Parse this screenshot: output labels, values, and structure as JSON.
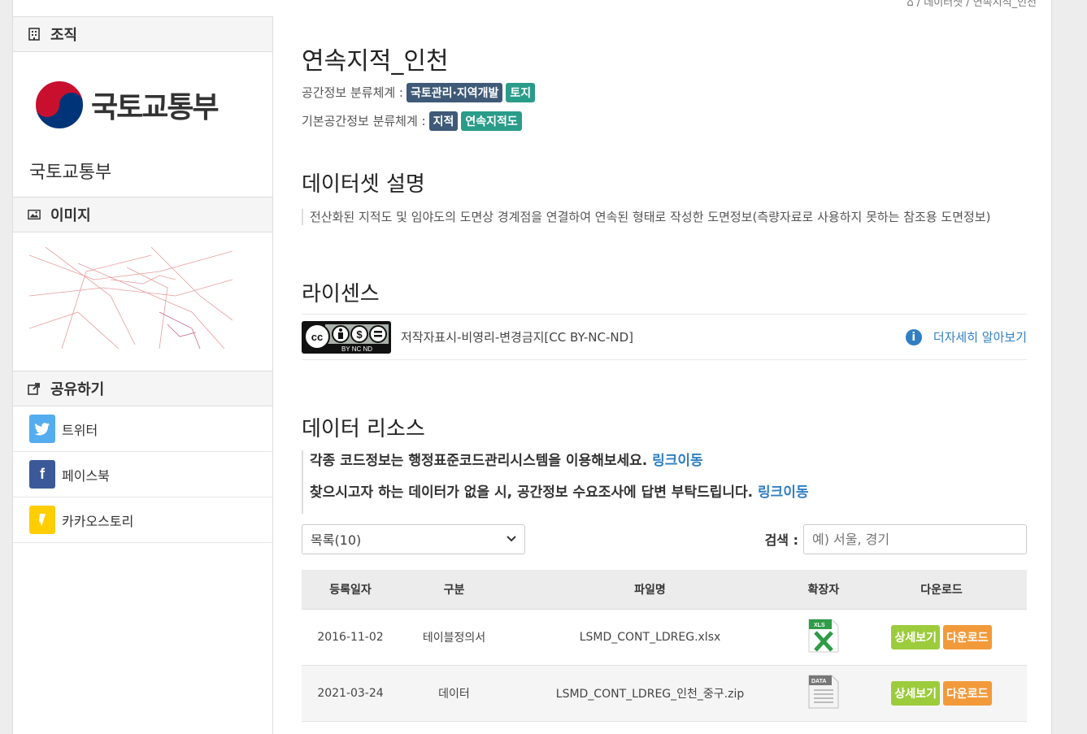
{
  "breadcrumb": {
    "text": "⌂ / 데이터셋 / 연속지적_인천"
  },
  "sidebar": {
    "org_header": "조직",
    "org_logo_text": "국토교통부",
    "org_name": "국토교통부",
    "image_header": "이미지",
    "share_header": "공유하기",
    "share_items": [
      {
        "label": "트위터",
        "icon": "twitter-icon",
        "color": "#55acee"
      },
      {
        "label": "페이스북",
        "icon": "facebook-icon",
        "color": "#3b5998"
      },
      {
        "label": "카카오스토리",
        "icon": "kakaostory-icon",
        "color": "#ffcd00"
      }
    ]
  },
  "dataset": {
    "title": "연속지적_인천",
    "spatial_label": "공간정보 분류체계 :",
    "spatial_tags": [
      "국토관리·지역개발",
      "토지"
    ],
    "base_label": "기본공간정보 분류체계 :",
    "base_tags": [
      "지적",
      "연속지적도"
    ]
  },
  "description": {
    "heading": "데이터셋 설명",
    "text": "전산화된 지적도 및 임야도의 도면상 경계점을 연결하여 연속된 형태로 작성한 도면정보(측량자료로 사용하지 못하는 참조용 도면정보)"
  },
  "license": {
    "heading": "라이센스",
    "badge": "cc BY NC ND",
    "text": "저작자표시-비영리-변경금지[CC BY-NC-ND]",
    "more_label": "더자세히 알아보기"
  },
  "resources": {
    "heading": "데이터 리소스",
    "notice1": "각종 코드정보는 행정표준코드관리시스템을 이용해보세요.",
    "notice2": "찾으시고자 하는 데이터가 없을 시, 공간정보 수요조사에 답변 부탁드립니다.",
    "link_label": "링크이동",
    "select_value": "목록(10)",
    "search_label": "검색 :",
    "search_placeholder": "예) 서울, 경기",
    "columns": [
      "등록일자",
      "구분",
      "파일명",
      "확장자",
      "다운로드"
    ],
    "rows": [
      {
        "date": "2016-11-02",
        "type": "테이블정의서",
        "file": "LSMD_CONT_LDREG.xlsx",
        "ext_icon": "xls-file-icon",
        "ext_text": "XLS",
        "detail": "상세보기",
        "download": "다운로드"
      },
      {
        "date": "2021-03-24",
        "type": "데이터",
        "file": "LSMD_CONT_LDREG_인천_중구.zip",
        "ext_icon": "data-file-icon",
        "ext_text": "DATA",
        "detail": "상세보기",
        "download": "다운로드"
      }
    ]
  }
}
